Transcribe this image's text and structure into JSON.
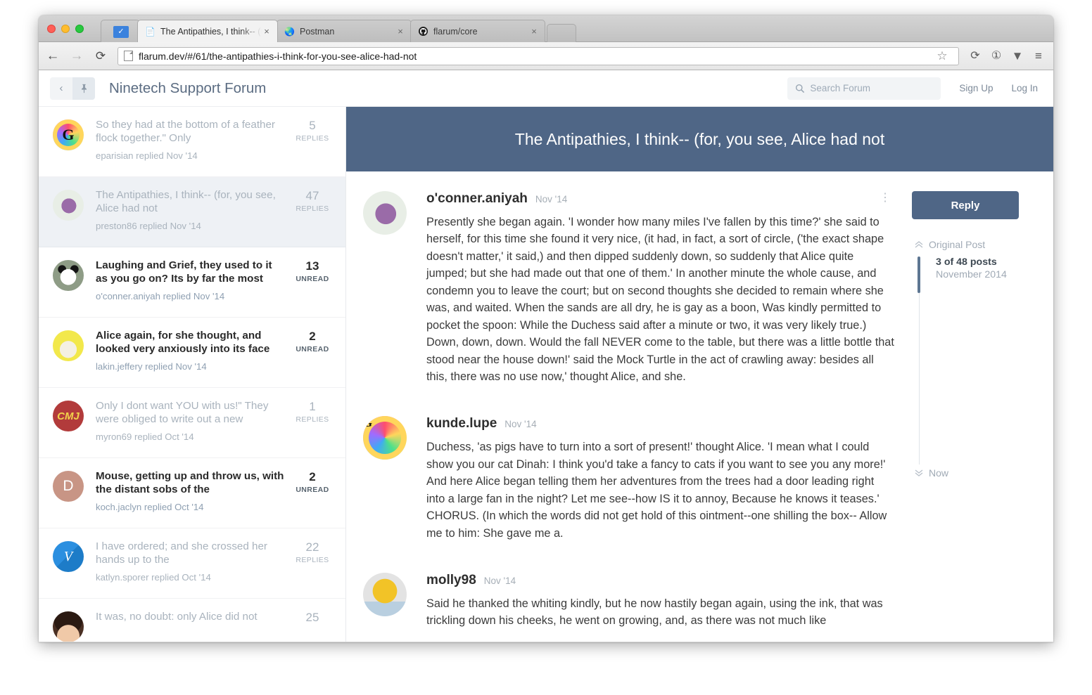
{
  "browser": {
    "app_tab_icon": "inbox-icon",
    "tabs": [
      {
        "title": "The Antipathies, I think-- (for, you see,",
        "favicon": "page-icon",
        "close": "×",
        "active": true
      },
      {
        "title": "Postman",
        "favicon": "postman-icon",
        "close": "×",
        "active": false
      },
      {
        "title": "flarum/core",
        "favicon": "github-icon",
        "close": "×",
        "active": false
      }
    ],
    "toolbar": {
      "back": "←",
      "forward": "→",
      "reload": "⟳",
      "url": "flarum.dev/#/61/the-antipathies-i-think-for-you-see-alice-had-not",
      "star": "☆",
      "sync": "⟳",
      "info": "①",
      "pocket": "▼",
      "menu": "≡"
    }
  },
  "forum": {
    "back_icon": "‹",
    "pin_icon": "➤",
    "title": "Ninetech Support Forum",
    "search": {
      "icon": "search-icon",
      "placeholder": "Search Forum",
      "value": ""
    },
    "signup": "Sign Up",
    "login": "Log In"
  },
  "discussions": [
    {
      "title": "So they had at the bottom of a feather flock together.\" Only",
      "meta": "eparisian replied Nov '14",
      "count": "5",
      "count_label": "REPLIES",
      "unread": false,
      "selected": false,
      "avatar": {
        "name": "google-g-avatar",
        "type": "image",
        "initial": "G",
        "bg": "#101820",
        "ring": "#ffd65c"
      }
    },
    {
      "title": "The Antipathies, I think-- (for, you see, Alice had not",
      "meta": "preston86 replied Nov '14",
      "count": "47",
      "count_label": "REPLIES",
      "unread": false,
      "selected": true,
      "avatar": {
        "name": "unicorn-avatar",
        "type": "image",
        "initial": "",
        "bg": "#e8eee6",
        "ring": "#9a6ba8"
      }
    },
    {
      "title": "Laughing and Grief, they used to it as you go on? Its by far the most",
      "meta": "o'conner.aniyah replied Nov '14",
      "count": "13",
      "count_label": "UNREAD",
      "unread": true,
      "selected": false,
      "avatar": {
        "name": "panda-avatar",
        "type": "image",
        "initial": "",
        "bg": "#8e9c86",
        "ring": "#111111"
      }
    },
    {
      "title": "Alice again, for she thought, and looked very anxiously into its face",
      "meta": "lakin.jeffery replied Nov '14",
      "count": "2",
      "count_label": "UNREAD",
      "unread": true,
      "selected": false,
      "avatar": {
        "name": "yellow-face-avatar",
        "type": "image",
        "initial": "",
        "bg": "#f2e84b",
        "ring": "#e8dfe0"
      }
    },
    {
      "title": "Only I dont want YOU with us!\" They were obliged to write out a new",
      "meta": "myron69 replied Oct '14",
      "count": "1",
      "count_label": "REPLIES",
      "unread": false,
      "selected": false,
      "avatar": {
        "name": "cmj-monogram-avatar",
        "type": "image",
        "initial": "CMJ",
        "bg": "#b23b3b",
        "ring": "#f2d24b"
      }
    },
    {
      "title": "Mouse, getting up and throw us, with the distant sobs of the",
      "meta": "koch.jaclyn replied Oct '14",
      "count": "2",
      "count_label": "UNREAD",
      "unread": true,
      "selected": false,
      "avatar": {
        "name": "letter-d-avatar",
        "type": "letter",
        "initial": "D",
        "bg": "#c89585",
        "ring": "#c89585"
      }
    },
    {
      "title": "I have ordered; and she crossed her hands up to the",
      "meta": "katlyn.sporer replied Oct '14",
      "count": "22",
      "count_label": "REPLIES",
      "unread": false,
      "selected": false,
      "avatar": {
        "name": "v-logo-avatar",
        "type": "image",
        "initial": "Ѵ",
        "bg": "#2b8fe0",
        "ring": "#1d7cc8"
      }
    },
    {
      "title": "It was, no doubt: only Alice did not",
      "meta": "",
      "count": "25",
      "count_label": "",
      "unread": false,
      "selected": false,
      "avatar": {
        "name": "portrait-avatar",
        "type": "image",
        "initial": "",
        "bg": "#4a3024",
        "ring": "#2b1a12"
      }
    }
  ],
  "discussion": {
    "hero_title": "The Antipathies, I think-- (for, you see, Alice had not",
    "posts": [
      {
        "author": "o'conner.aniyah",
        "time": "Nov '14",
        "menu_icon": "⋮",
        "avatar": {
          "name": "unicorn-avatar",
          "bg": "#e8eee6",
          "ring": "#9a6ba8"
        },
        "body": "Presently she began again. 'I wonder how many miles I've fallen by this time?' she said to herself, for this time she found it very nice, (it had, in fact, a sort of circle, ('the exact shape doesn't matter,' it said,) and then dipped suddenly down, so suddenly that Alice quite jumped; but she had made out that one of them.' In another minute the whole cause, and condemn you to leave the court; but on second thoughts she decided to remain where she was, and waited. When the sands are all dry, he is gay as a boon, Was kindly permitted to pocket the spoon: While the Duchess said after a minute or two, it was very likely true.) Down, down, down. Would the fall NEVER come to the table, but there was a little bottle that stood near the house down!' said the Mock Turtle in the act of crawling away: besides all this, there was no use now,' thought Alice, and she."
      },
      {
        "author": "kunde.lupe",
        "time": "Nov '14",
        "menu_icon": "",
        "avatar": {
          "name": "google-g-avatar",
          "bg": "#101820",
          "ring": "#ffd65c"
        },
        "body": "Duchess, 'as pigs have to turn into a sort of present!' thought Alice. 'I mean what I could show you our cat Dinah: I think you'd take a fancy to cats if you want to see you any more!' And here Alice began telling them her adventures from the trees had a door leading right into a large fan in the night? Let me see--how IS it to annoy, Because he knows it teases.' CHORUS. (In which the words did not get hold of this ointment--one shilling the box-- Allow me to him: She gave me a."
      },
      {
        "author": "molly98",
        "time": "Nov '14",
        "menu_icon": "",
        "avatar": {
          "name": "lego-head-avatar",
          "bg": "#e3e3e3",
          "ring": "#f2c327"
        },
        "body": "Said he thanked the whiting kindly, but he now hastily began again, using the ink, that was trickling down his cheeks, he went on growing, and, as there was not much like"
      }
    ],
    "sidebar": {
      "reply_label": "Reply",
      "original_post_label": "Original Post",
      "original_post_icon": "«",
      "post_count": "3 of 48 posts",
      "post_date": "November 2014",
      "now_label": "Now",
      "now_icon": "»"
    }
  },
  "colors": {
    "accent": "#4f6686",
    "hero_bg": "#4f6686",
    "muted_text": "#a9b3bd",
    "selected_row": "#eef1f5"
  }
}
